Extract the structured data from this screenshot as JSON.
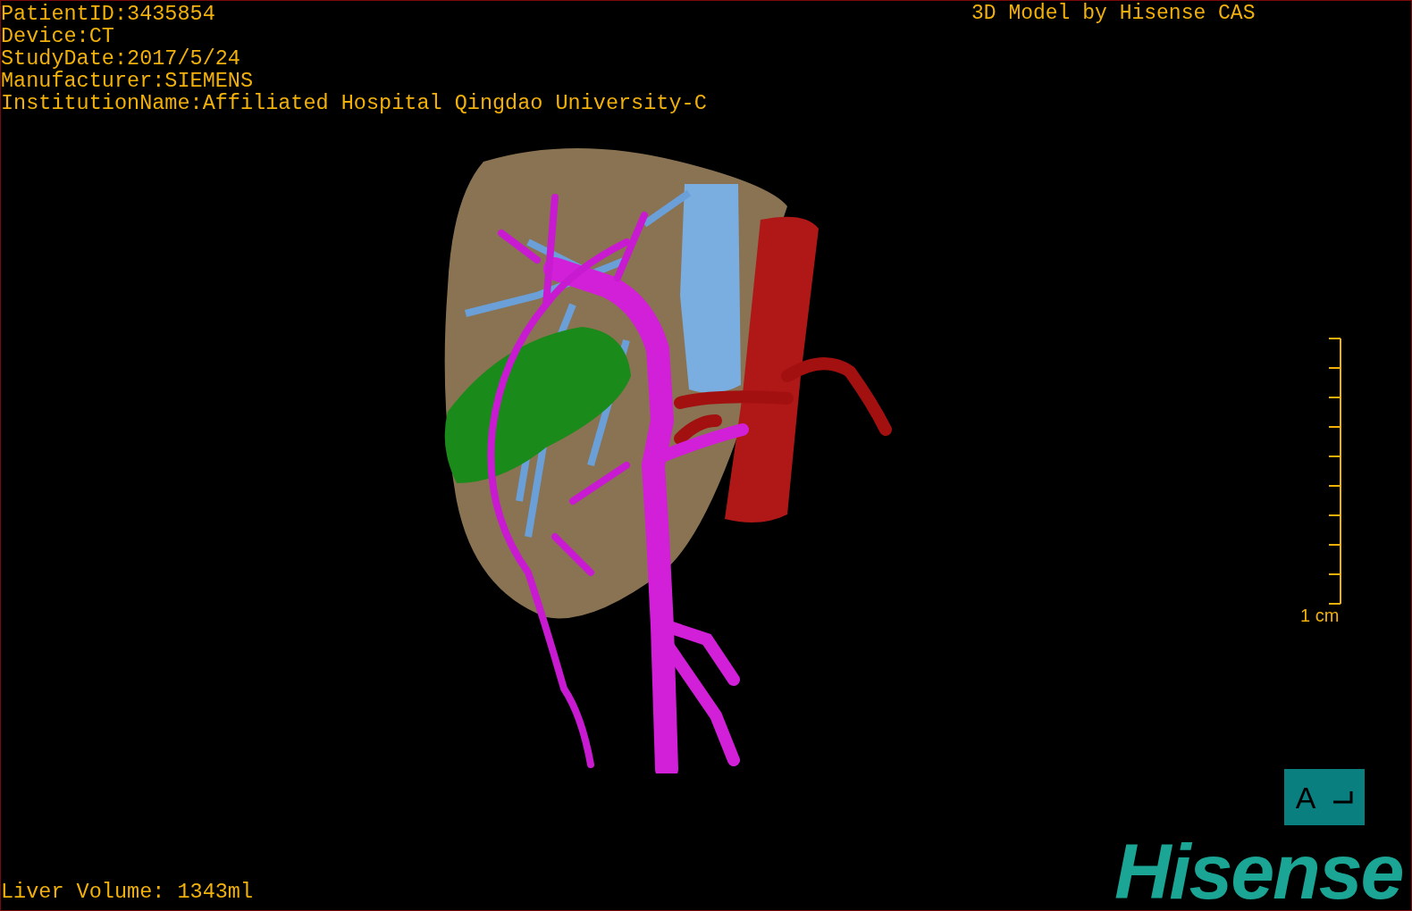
{
  "patient_info": [
    "PatientID:3435854",
    "Device:CT",
    "StudyDate:2017/5/24",
    "Manufacturer:SIEMENS",
    "InstitutionName:Affiliated Hospital Qingdao University-C"
  ],
  "header_title": "3D Model by Hisense CAS",
  "scale_bar": {
    "label": "1 cm"
  },
  "orientation_marker": {
    "label": "A"
  },
  "liver_volume": "Liver Volume: 1343ml",
  "logo": "Hisense"
}
